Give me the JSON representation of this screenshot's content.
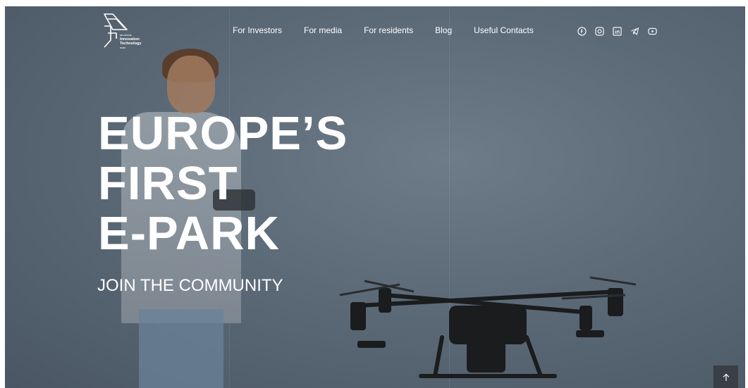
{
  "logo": {
    "lines": [
      "BELGRADE",
      "Innovation",
      "Technology",
      "PARK"
    ]
  },
  "nav": {
    "items": [
      {
        "label": "For Investors"
      },
      {
        "label": "For media"
      },
      {
        "label": "For residents"
      },
      {
        "label": "Blog"
      },
      {
        "label": "Useful Contacts"
      }
    ]
  },
  "socials": {
    "icons": [
      "facebook-icon",
      "instagram-icon",
      "linkedin-icon",
      "telegram-icon",
      "youtube-icon"
    ]
  },
  "hero": {
    "title_lines": [
      "EUROPE’S",
      "FIRST",
      "E-PARK"
    ],
    "subtitle": "JOIN THE COMMUNITY"
  },
  "colors": {
    "background": "#5c6a78",
    "text": "#ffffff",
    "scroll_button": "#3a3f45"
  }
}
